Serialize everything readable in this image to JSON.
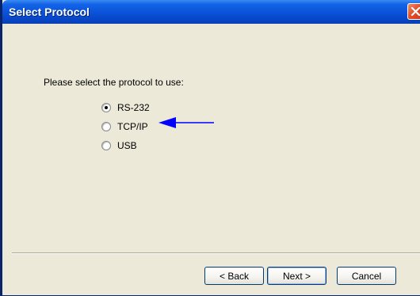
{
  "window": {
    "title": "Select Protocol"
  },
  "dialog": {
    "prompt": "Please select the protocol to use:",
    "options": [
      {
        "label": "RS-232",
        "checked": true
      },
      {
        "label": "TCP/IP",
        "checked": false
      },
      {
        "label": "USB",
        "checked": false
      }
    ],
    "arrow_color": "#0000ff"
  },
  "buttons": {
    "back_label": "< Back",
    "next_label": "Next >",
    "cancel_label": "Cancel"
  },
  "colors": {
    "titlebar": "#0a52d8",
    "dialog_bg": "#ece9d8",
    "close_button": "#e5502c"
  }
}
